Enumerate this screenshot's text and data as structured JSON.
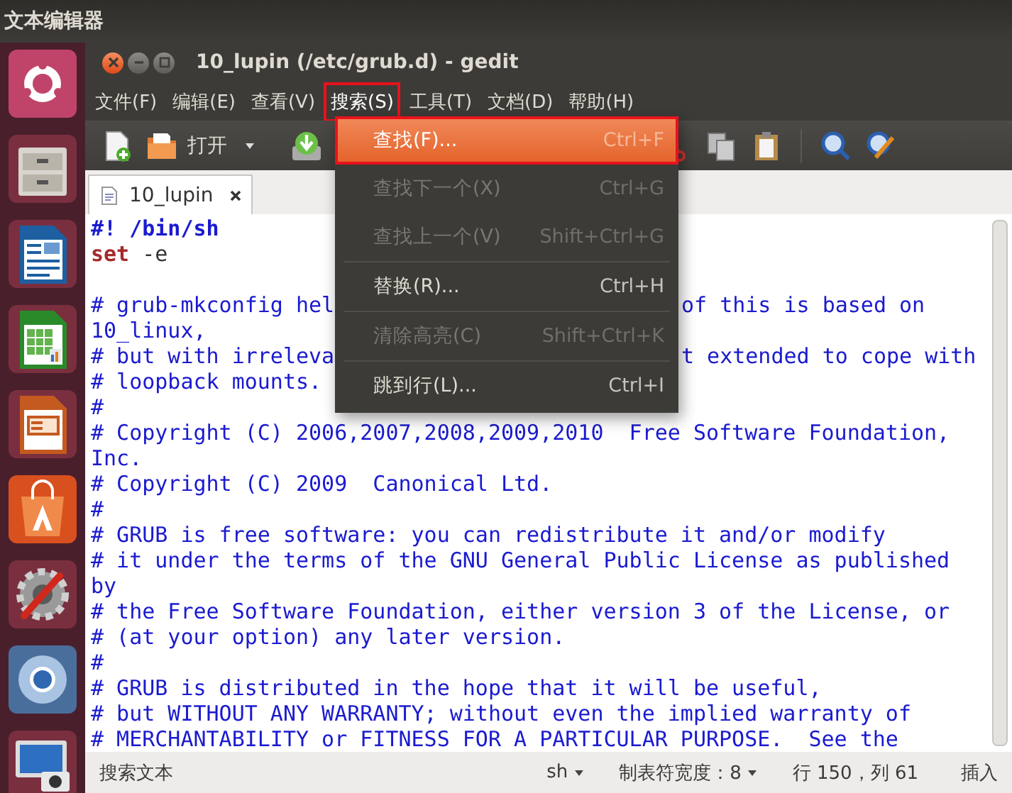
{
  "top_panel": {
    "title": "文本编辑器"
  },
  "launcher": {
    "items": [
      {
        "kind": "ubuntu"
      },
      {
        "kind": "files"
      },
      {
        "kind": "writer"
      },
      {
        "kind": "calc"
      },
      {
        "kind": "impress"
      },
      {
        "kind": "software"
      },
      {
        "kind": "settings"
      },
      {
        "kind": "browser"
      },
      {
        "kind": "screenshot"
      }
    ]
  },
  "window": {
    "title": "10_lupin (/etc/grub.d) - gedit"
  },
  "menu_bar": [
    {
      "label": "文件(F)",
      "selected": false,
      "marked": false
    },
    {
      "label": "编辑(E)",
      "selected": false,
      "marked": false
    },
    {
      "label": "查看(V)",
      "selected": false,
      "marked": false
    },
    {
      "label": "搜索(S)",
      "selected": true,
      "marked": true
    },
    {
      "label": "工具(T)",
      "selected": false,
      "marked": false
    },
    {
      "label": "文档(D)",
      "selected": false,
      "marked": false
    },
    {
      "label": "帮助(H)",
      "selected": false,
      "marked": false
    }
  ],
  "toolbar": {
    "open_label": "打开"
  },
  "search_menu": [
    {
      "kind": "item",
      "label": "查找(F)...",
      "shortcut": "Ctrl+F",
      "selected": true,
      "disabled": false,
      "marked": true
    },
    {
      "kind": "item",
      "label": "查找下一个(X)",
      "shortcut": "Ctrl+G",
      "selected": false,
      "disabled": true,
      "marked": false
    },
    {
      "kind": "item",
      "label": "查找上一个(V)",
      "shortcut": "Shift+Ctrl+G",
      "selected": false,
      "disabled": true,
      "marked": false
    },
    {
      "kind": "separator"
    },
    {
      "kind": "item",
      "label": "替换(R)...",
      "shortcut": "Ctrl+H",
      "selected": false,
      "disabled": false,
      "marked": false
    },
    {
      "kind": "separator"
    },
    {
      "kind": "item",
      "label": "清除高亮(C)",
      "shortcut": "Shift+Ctrl+K",
      "selected": false,
      "disabled": true,
      "marked": false
    },
    {
      "kind": "separator"
    },
    {
      "kind": "item",
      "label": "跳到行(L)...",
      "shortcut": "Ctrl+I",
      "selected": false,
      "disabled": false,
      "marked": false
    }
  ],
  "tabs": [
    {
      "label": "10_lupin",
      "selected": true
    }
  ],
  "editor_lines": [
    {
      "kind": "shebang",
      "text": "#! /bin/sh"
    },
    {
      "kind": "command",
      "keyword": "set",
      "text": " -e"
    },
    {
      "kind": "blank"
    },
    {
      "kind": "comment",
      "text": "# grub-mkconfig hel",
      "tail": "of this is based on"
    },
    {
      "kind": "comment",
      "text": "10_linux,"
    },
    {
      "kind": "comment",
      "text": "# but with irreleva",
      "tail": "t extended to cope with"
    },
    {
      "kind": "comment",
      "text": "# loopback mounts."
    },
    {
      "kind": "comment",
      "text": "#"
    },
    {
      "kind": "comment",
      "text": "# Copyright (C) 2006,2007,2008,2009,2010  Free Software Foundation,"
    },
    {
      "kind": "comment",
      "text": "Inc."
    },
    {
      "kind": "comment",
      "text": "# Copyright (C) 2009  Canonical Ltd."
    },
    {
      "kind": "comment",
      "text": "#"
    },
    {
      "kind": "comment",
      "text": "# GRUB is free software: you can redistribute it and/or modify"
    },
    {
      "kind": "comment",
      "text": "# it under the terms of the GNU General Public License as published"
    },
    {
      "kind": "comment",
      "text": "by"
    },
    {
      "kind": "comment",
      "text": "# the Free Software Foundation, either version 3 of the License, or"
    },
    {
      "kind": "comment",
      "text": "# (at your option) any later version."
    },
    {
      "kind": "comment",
      "text": "#"
    },
    {
      "kind": "comment",
      "text": "# GRUB is distributed in the hope that it will be useful,"
    },
    {
      "kind": "comment",
      "text": "# but WITHOUT ANY WARRANTY; without even the implied warranty of"
    },
    {
      "kind": "comment",
      "text": "# MERCHANTABILITY or FITNESS FOR A PARTICULAR PURPOSE.  See the"
    }
  ],
  "status_bar": {
    "message": "搜索文本",
    "language": "sh",
    "tab_width": "制表符宽度：8",
    "position": "行 150，列 61",
    "mode": "插入"
  }
}
